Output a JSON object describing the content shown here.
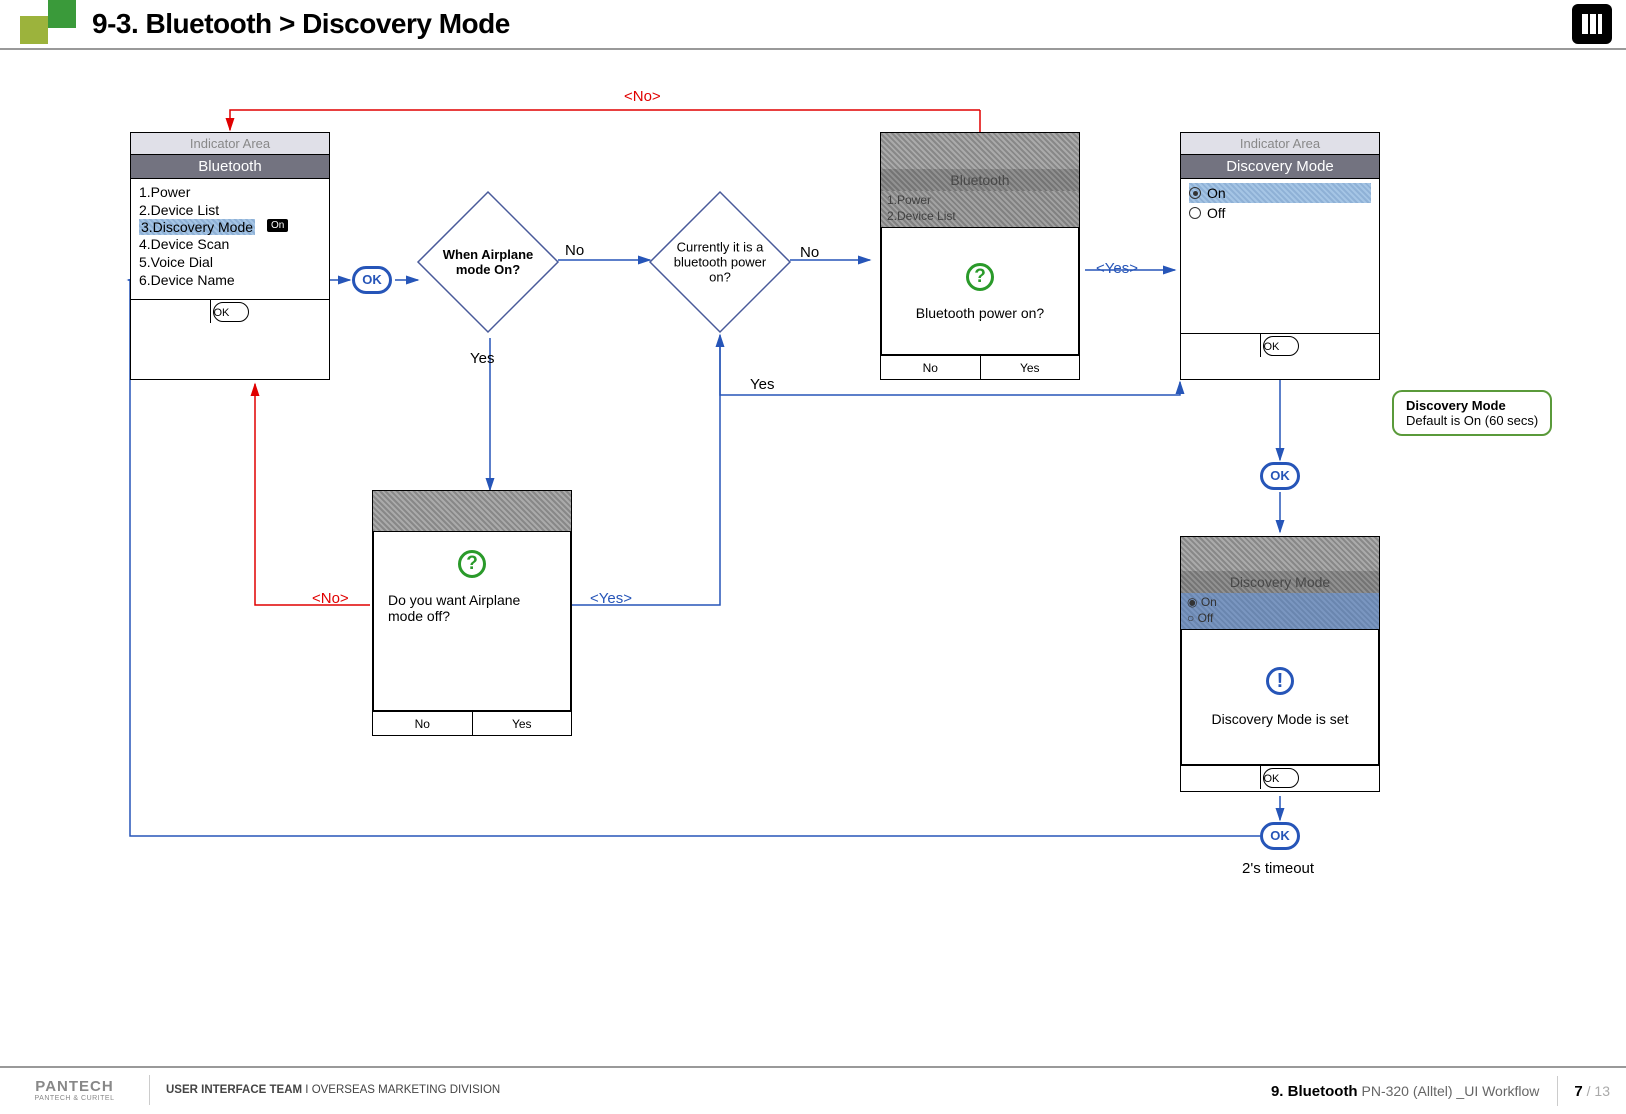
{
  "header": {
    "title": "9-3. Bluetooth > Discovery Mode"
  },
  "footer": {
    "logo_main": "PANTECH",
    "logo_sub": "PANTECH & CURITEL",
    "team_bold": "USER INTERFACE TEAM",
    "team_sep": "  I  ",
    "team_rest": "OVERSEAS MARKETING DIVISION",
    "section_bold": "9. Bluetooth",
    "section_rest": " PN-320 (Alltel) _UI Workflow",
    "page_cur": "7",
    "page_total": " / 13"
  },
  "screen1": {
    "indicator": "Indicator Area",
    "title": "Bluetooth",
    "items": [
      "1.Power",
      "2.Device List",
      "3.Discovery Mode",
      "4.Device Scan",
      "5.Voice Dial",
      "6.Device Name"
    ],
    "sel_badge": "On",
    "ok": "OK"
  },
  "ok_pill1": "OK",
  "decision1": {
    "text": "When Airplane mode On?",
    "no": "No",
    "yes": "Yes"
  },
  "decision2": {
    "text": "Currently it is a bluetooth power on?",
    "no": "No",
    "yes": "Yes"
  },
  "popup_airplane": {
    "msg": "Do you want Airplane mode off?",
    "no": "No",
    "yes": "Yes",
    "edge_no": "<No>",
    "edge_yes": "<Yes>"
  },
  "popup_btpower": {
    "title": "Bluetooth",
    "items": [
      "1.Power",
      "2.Device List"
    ],
    "msg": "Bluetooth power on?",
    "no": "No",
    "yes": "Yes",
    "edge_no": "<No>",
    "edge_yes": "<Yes>"
  },
  "screen_discovery": {
    "indicator": "Indicator Area",
    "title": "Discovery Mode",
    "opt_on": "On",
    "opt_off": "Off",
    "ok": "OK"
  },
  "note": {
    "title": "Discovery Mode",
    "body": "Default is On (60 secs)"
  },
  "ok_pill2": "OK",
  "popup_set": {
    "title": "Discovery Mode",
    "opt_on": "On",
    "opt_off": "Off",
    "msg": "Discovery Mode is set",
    "ok": "OK"
  },
  "ok_pill3": "OK",
  "timeout": "2's timeout"
}
